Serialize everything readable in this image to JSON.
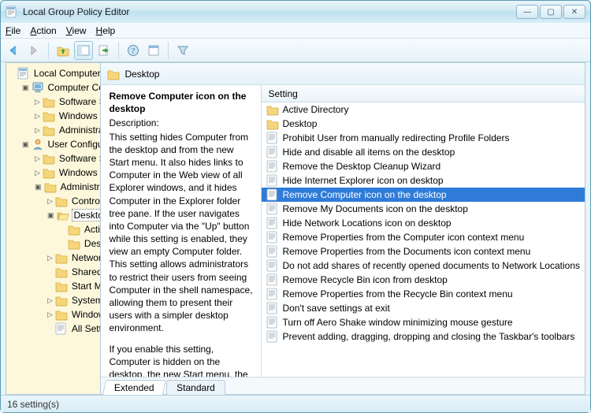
{
  "window": {
    "title": "Local Group Policy Editor",
    "menu": {
      "file": "File",
      "action": "Action",
      "view": "View",
      "help": "Help"
    }
  },
  "tree": {
    "root": "Local Computer Policy",
    "cc": "Computer Configuration",
    "cc_soft": "Software Settings",
    "cc_win": "Windows Settings",
    "cc_admin": "Administrative Templates",
    "uc": "User Configuration",
    "uc_soft": "Software Settings",
    "uc_win": "Windows Settings",
    "uc_admin": "Administrative Templates",
    "uc_cp": "Control Panel",
    "uc_desktop": "Desktop",
    "uc_desktop_ad": "Active Directory",
    "uc_desktop_desk": "Desktop",
    "uc_network": "Network",
    "uc_shared": "Shared Folders",
    "uc_start": "Start Menu and Taskbar",
    "uc_system": "System",
    "uc_wincomp": "Windows Components",
    "uc_all": "All Settings"
  },
  "content": {
    "header": "Desktop",
    "setting_col": "Setting",
    "selected_title": "Remove Computer icon on the desktop",
    "description_label": "Description:",
    "description_body": "This setting hides Computer from the desktop and from the new Start menu. It also hides links to Computer in the Web view of all Explorer windows, and it hides Computer in the Explorer folder tree pane. If the user navigates into Computer via the \"Up\" button while this setting is enabled, they view an empty Computer folder. This setting allows administrators to restrict their users from seeing Computer in the shell namespace, allowing them to present their users with a simpler desktop environment.",
    "description_more": "If you enable this setting, Computer is hidden on the desktop, the new Start menu, the Explorer folder tree pane, and the",
    "items": [
      {
        "type": "folder",
        "label": "Active Directory",
        "selected": false
      },
      {
        "type": "folder",
        "label": "Desktop",
        "selected": false
      },
      {
        "type": "setting",
        "label": "Prohibit User from manually redirecting Profile Folders",
        "selected": false
      },
      {
        "type": "setting",
        "label": "Hide and disable all items on the desktop",
        "selected": false
      },
      {
        "type": "setting",
        "label": "Remove the Desktop Cleanup Wizard",
        "selected": false
      },
      {
        "type": "setting",
        "label": "Hide Internet Explorer icon on desktop",
        "selected": false
      },
      {
        "type": "setting",
        "label": "Remove Computer icon on the desktop",
        "selected": true
      },
      {
        "type": "setting",
        "label": "Remove My Documents icon on the desktop",
        "selected": false
      },
      {
        "type": "setting",
        "label": "Hide Network Locations icon on desktop",
        "selected": false
      },
      {
        "type": "setting",
        "label": "Remove Properties from the Computer icon context menu",
        "selected": false
      },
      {
        "type": "setting",
        "label": "Remove Properties from the Documents icon context menu",
        "selected": false
      },
      {
        "type": "setting",
        "label": "Do not add shares of recently opened documents to Network Locations",
        "selected": false
      },
      {
        "type": "setting",
        "label": "Remove Recycle Bin icon from desktop",
        "selected": false
      },
      {
        "type": "setting",
        "label": "Remove Properties from the Recycle Bin context menu",
        "selected": false
      },
      {
        "type": "setting",
        "label": "Don't save settings at exit",
        "selected": false
      },
      {
        "type": "setting",
        "label": "Turn off Aero Shake window minimizing mouse gesture",
        "selected": false
      },
      {
        "type": "setting",
        "label": "Prevent adding, dragging, dropping and closing the Taskbar's toolbars",
        "selected": false
      }
    ],
    "tabs": {
      "extended": "Extended",
      "standard": "Standard"
    }
  },
  "status": "16 setting(s)"
}
